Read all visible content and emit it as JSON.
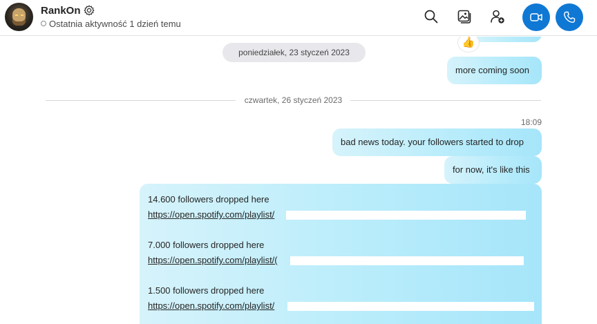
{
  "header": {
    "contact_name": "RankOn",
    "status": "Ostatnia aktywność 1 dzień temu",
    "icons": [
      "gear-icon",
      "search-icon",
      "gallery-icon",
      "add-person-icon",
      "video-call-icon",
      "phone-call-icon"
    ],
    "call_button_color": "#0f78d4"
  },
  "thread": {
    "reaction_emoji": "👍",
    "date_pill": "poniedziałek, 23 styczeń 2023",
    "msg_more_coming": "more coming soon",
    "date_divider": "czwartek, 26 styczeń 2023",
    "time": "18:09",
    "msg_bad_news": "bad news today. your followers started to drop",
    "msg_for_now": "for now, it's like this",
    "drops": [
      {
        "text": "14.600 followers dropped here",
        "link": "https://open.spotify.com/playlist/"
      },
      {
        "text": "7.000 followers dropped here",
        "link": "https://open.spotify.com/playlist/("
      },
      {
        "text": "1.500 followers dropped here",
        "link": "https://open.spotify.com/playlist/"
      }
    ]
  },
  "colors": {
    "bubble_start": "#d6f3fb",
    "bubble_end": "#a6e5fa",
    "accent": "#0f78d4"
  }
}
